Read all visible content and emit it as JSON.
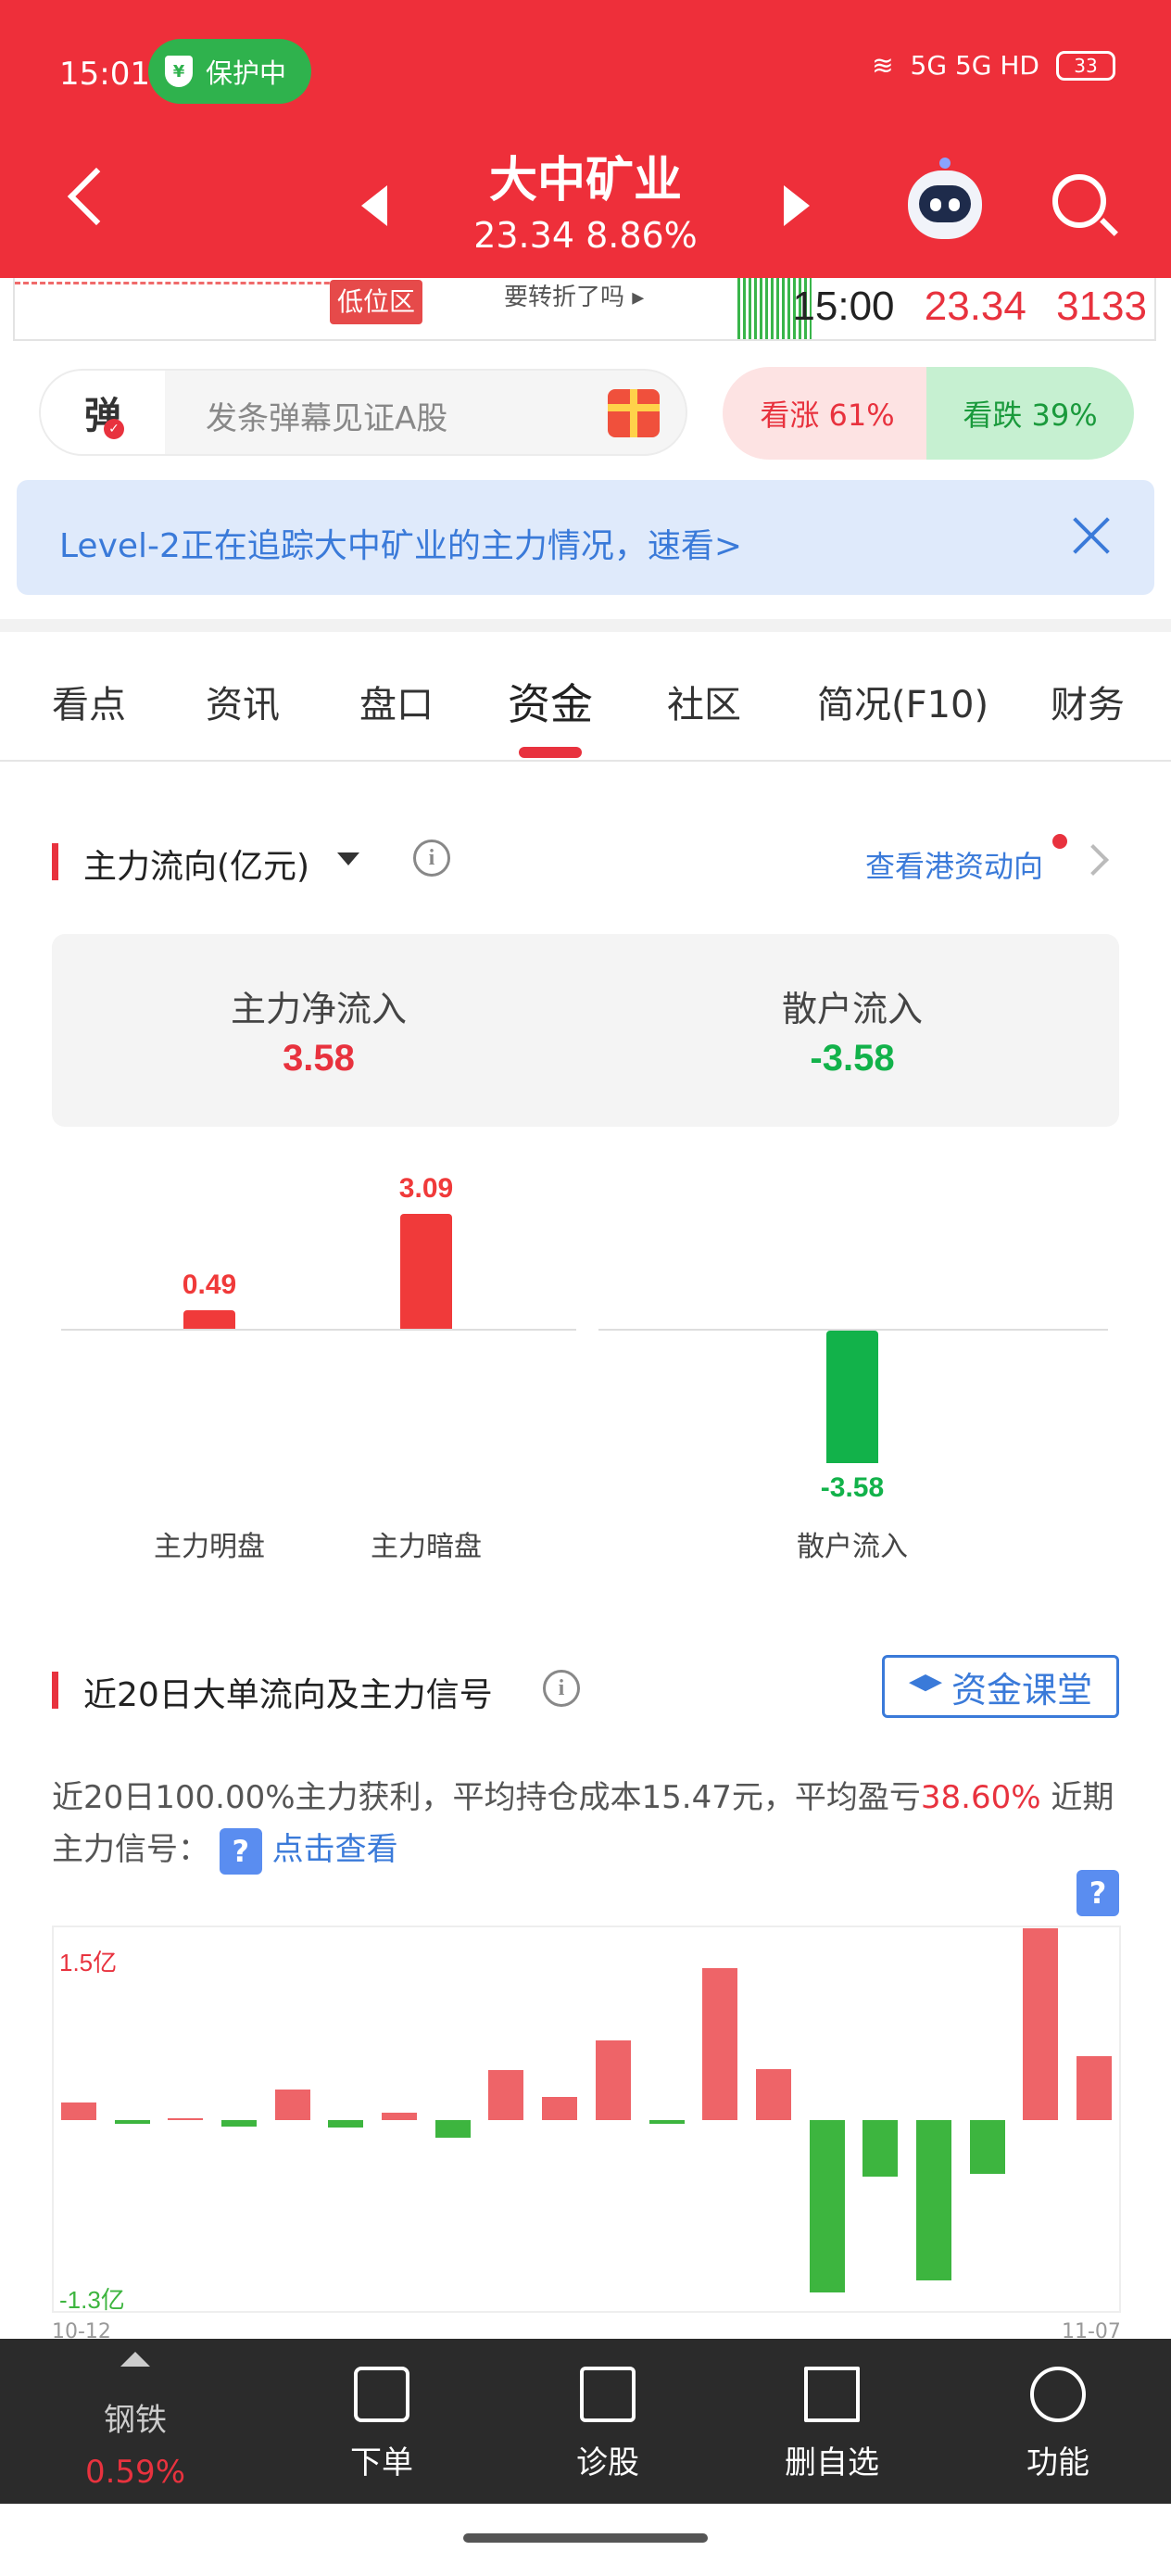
{
  "status_bar": {
    "time": "15:01",
    "protect_label": "保护中",
    "network": "5G 5G HD",
    "battery": "33"
  },
  "header": {
    "stock_name": "大中矿业",
    "price_line": "23.34  8.86%"
  },
  "strip": {
    "low_tag": "低位区",
    "turn_text": "要转折了吗 ▸",
    "time": "15:00",
    "price": "23.34",
    "volume": "3133"
  },
  "danmu": {
    "icon": "弹",
    "placeholder": "发条弹幕见证A股",
    "up_label": "看涨 61%",
    "down_label": "看跌 39%",
    "up_pct": 61,
    "down_pct": 39
  },
  "banner": {
    "text": "Level-2正在追踪大中矿业的主力情况，速看>"
  },
  "tabs": [
    "看点",
    "资讯",
    "盘口",
    "资金",
    "社区",
    "简况(F10)",
    "财务"
  ],
  "active_tab": "资金",
  "flow_section": {
    "title": "主力流向(亿元)",
    "hk_link": "查看港资动向",
    "main_net_label": "主力净流入",
    "main_net_value": "3.58",
    "retail_label": "散户流入",
    "retail_value": "-3.58"
  },
  "chart_data": [
    {
      "type": "bar",
      "categories": [
        "主力明盘",
        "主力暗盘",
        "散户流入"
      ],
      "values": [
        0.49,
        3.09,
        -3.58
      ],
      "labels": [
        "0.49",
        "3.09",
        "-3.58"
      ],
      "colors": [
        "#f03a3a",
        "#f03a3a",
        "#12b24a"
      ]
    },
    {
      "type": "bar",
      "title": "近20日大单流向及主力信号",
      "y_top_label": "1.5亿",
      "y_bottom_label": "-1.3亿",
      "x_start": "10-12",
      "x_end": "11-07",
      "values": [
        0.14,
        -0.03,
        0.0,
        -0.05,
        0.24,
        -0.06,
        0.06,
        -0.14,
        0.39,
        0.18,
        0.62,
        -0.03,
        1.19,
        0.4,
        -1.35,
        -0.44,
        -1.25,
        -0.42,
        1.5,
        0.5
      ],
      "ylim": [
        -1.3,
        1.5
      ]
    }
  ],
  "big_order": {
    "title": "近20日大单流向及主力信号",
    "course_label": "资金课堂",
    "desc_a": "近20日100.00%主力获利，平均持仓成本15.47元，平均盈亏",
    "desc_pct": "38.60%",
    "desc_b": " 近期主力信号：",
    "desc_link": "点击查看"
  },
  "bottom_nav": {
    "sector_name": "钢铁",
    "sector_change": "0.59%",
    "items": [
      "下单",
      "诊股",
      "删自选",
      "功能"
    ]
  },
  "colors": {
    "brand_red": "#ee2f3a",
    "up_red": "#e8323e",
    "down_green": "#12b24a",
    "link_blue": "#3a7ad9"
  }
}
